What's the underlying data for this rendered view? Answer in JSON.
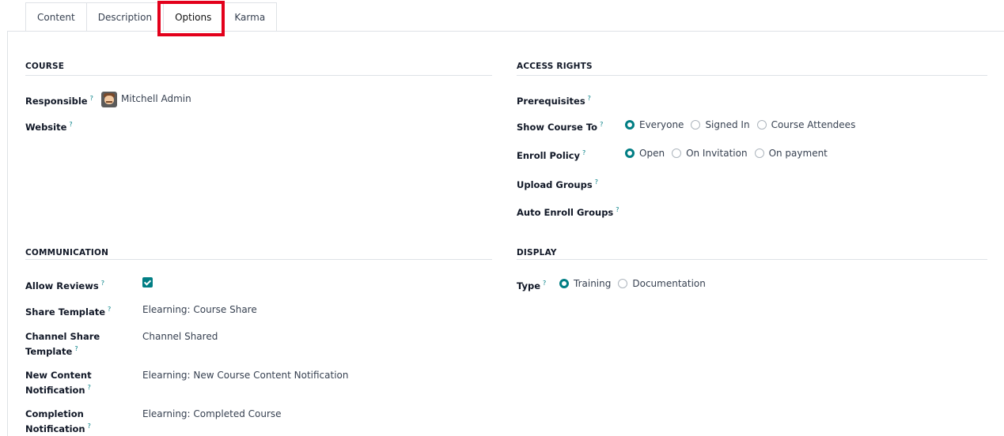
{
  "tabs": [
    {
      "label": "Content"
    },
    {
      "label": "Description"
    },
    {
      "label": "Options"
    },
    {
      "label": "Karma"
    }
  ],
  "active_tab": "Options",
  "help_marker": "?",
  "course": {
    "title": "COURSE",
    "responsible_label": "Responsible",
    "responsible_value": "Mitchell Admin",
    "website_label": "Website"
  },
  "access_rights": {
    "title": "ACCESS RIGHTS",
    "prerequisites_label": "Prerequisites",
    "show_course_to_label": "Show Course To",
    "show_course_to_options": [
      "Everyone",
      "Signed In",
      "Course Attendees"
    ],
    "show_course_to_selected": "Everyone",
    "enroll_policy_label": "Enroll Policy",
    "enroll_policy_options": [
      "Open",
      "On Invitation",
      "On payment"
    ],
    "enroll_policy_selected": "Open",
    "upload_groups_label": "Upload Groups",
    "auto_enroll_groups_label": "Auto Enroll Groups"
  },
  "communication": {
    "title": "COMMUNICATION",
    "allow_reviews_label": "Allow Reviews",
    "allow_reviews_checked": true,
    "share_template_label": "Share Template",
    "share_template_value": "Elearning: Course Share",
    "channel_share_label_1": "Channel Share",
    "channel_share_label_2": "Template",
    "channel_share_value": "Channel Shared",
    "new_content_label_1": "New Content",
    "new_content_label_2": "Notification",
    "new_content_value": "Elearning: New Course Content Notification",
    "completion_label_1": "Completion",
    "completion_label_2": "Notification",
    "completion_value": "Elearning: Completed Course"
  },
  "display": {
    "title": "DISPLAY",
    "type_label": "Type",
    "type_options": [
      "Training",
      "Documentation"
    ],
    "type_selected": "Training"
  },
  "colors": {
    "accent": "#017e84",
    "highlight": "#e3001b"
  }
}
